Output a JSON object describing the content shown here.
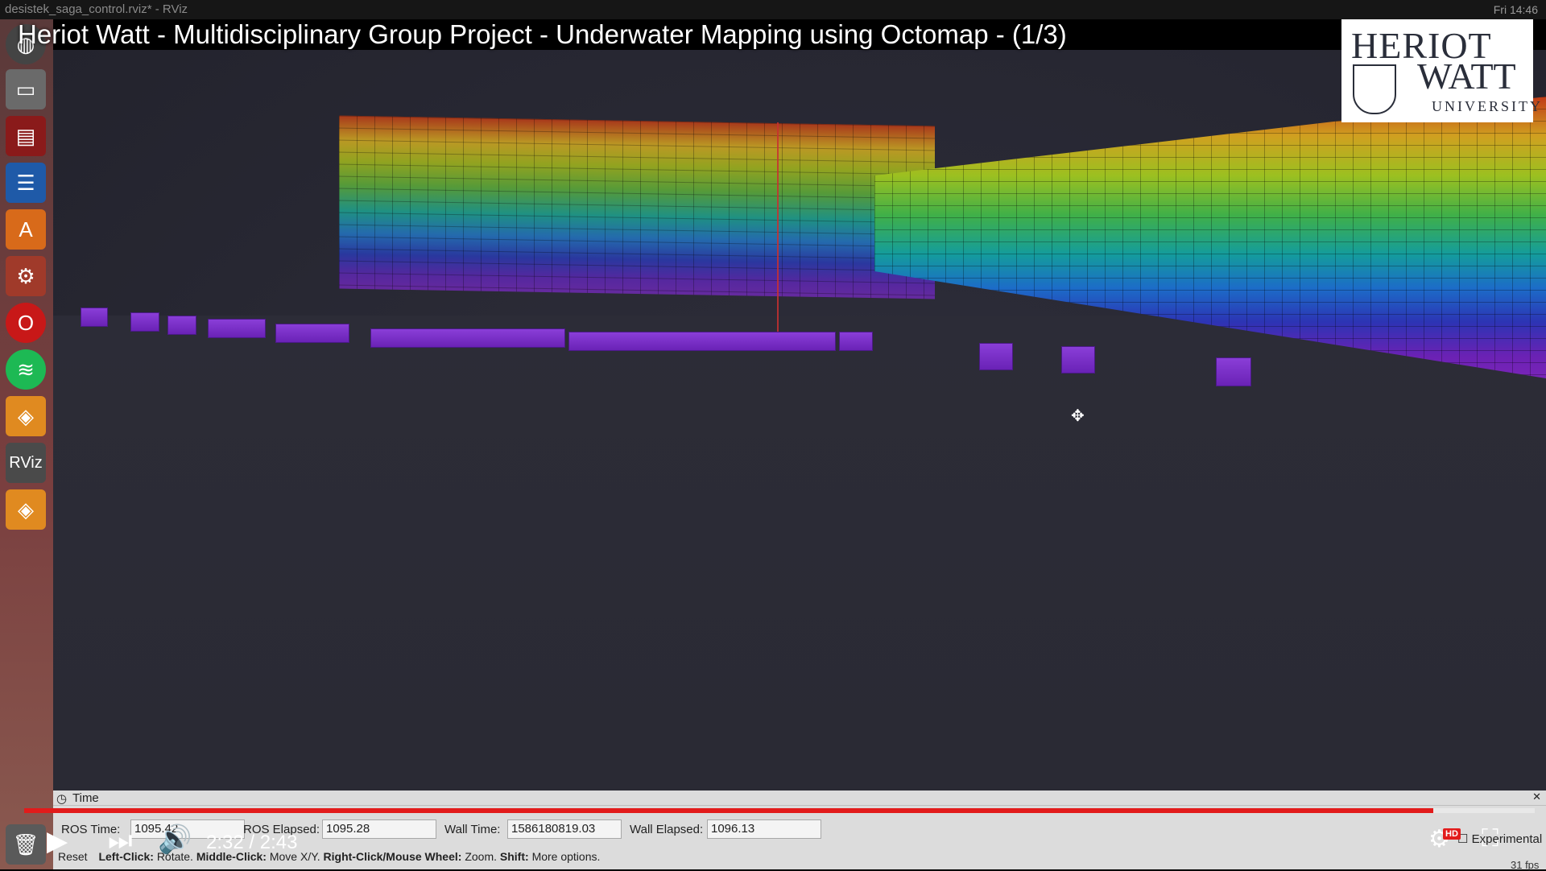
{
  "system_bar": {
    "window_title": "desistek_saga_control.rviz* - RViz",
    "clock": "14:46",
    "day": "Fri"
  },
  "video": {
    "title": "Heriot Watt - Multidisciplinary Group Project - Underwater Mapping using Octomap - (1/3)",
    "current_time": "2:32",
    "duration": "2:43",
    "timecode": "2:32 / 2:43",
    "progress": 0.933,
    "hd_badge": "HD"
  },
  "logo": {
    "line1": "HERIOT",
    "line2": "WATT",
    "line3": "UNIVERSITY"
  },
  "launcher": {
    "icons": [
      "dash-icon",
      "files-icon",
      "terminal-icon",
      "writer-icon",
      "software-center-icon",
      "settings-icon",
      "opera-icon",
      "spotify-icon",
      "app-icon",
      "rviz-icon",
      "app-icon-2",
      "trash-icon"
    ],
    "rviz_label": "RViz"
  },
  "time_panel": {
    "header": "Time",
    "ros_time_label": "ROS Time:",
    "ros_time": "1095.42",
    "ros_elapsed_label": "ROS Elapsed:",
    "ros_elapsed": "1095.28",
    "wall_time_label": "Wall Time:",
    "wall_time": "1586180819.03",
    "wall_elapsed_label": "Wall Elapsed:",
    "wall_elapsed": "1096.13",
    "experimental_label": "Experimental",
    "reset_label": "Reset",
    "hint_left_click": "Left-Click:",
    "hint_rotate": "Rotate.",
    "hint_middle_click": "Middle-Click:",
    "hint_move": "Move X/Y.",
    "hint_right_click": "Right-Click/Mouse Wheel:",
    "hint_zoom": "Zoom.",
    "hint_shift": "Shift:",
    "hint_more": "More options.",
    "fps": "31 fps"
  },
  "colors": {
    "progress": "#e21b1b",
    "viewport_bg": "#2a2a34",
    "panel_bg": "#dcdcdc"
  }
}
